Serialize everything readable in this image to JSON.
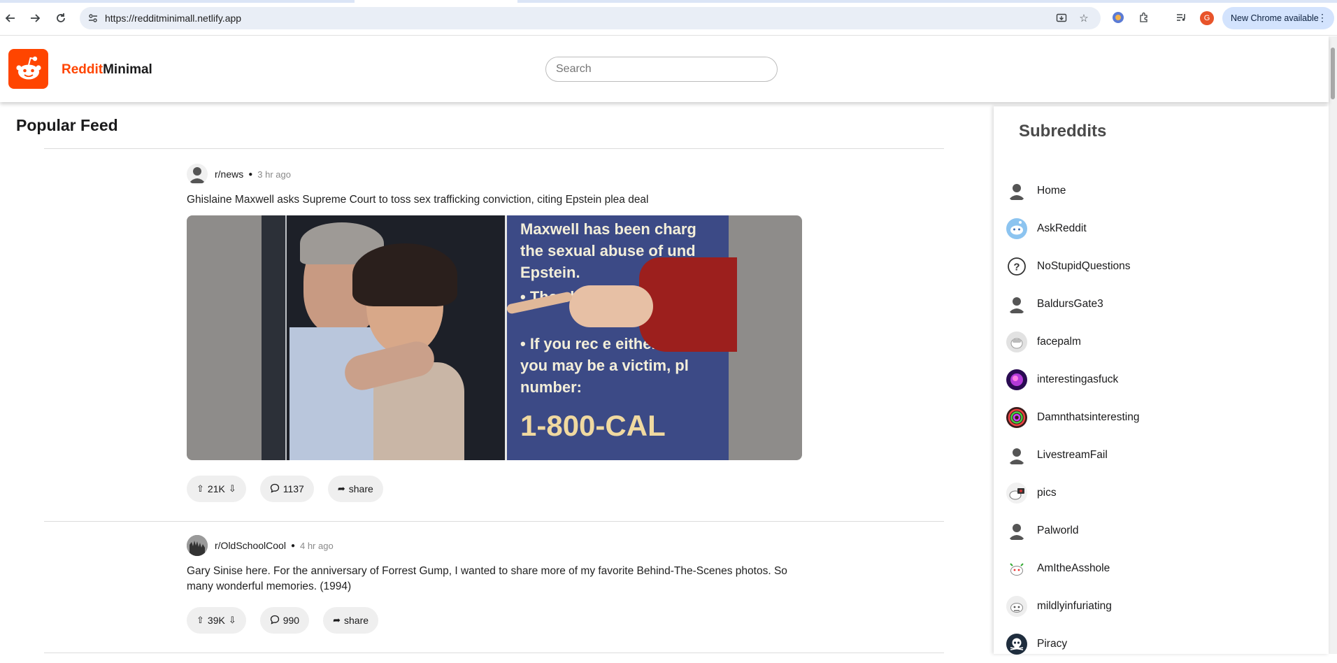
{
  "browser": {
    "url": "https://redditminimall.netlify.app",
    "update_label": "New Chrome available",
    "profile_initial": "G"
  },
  "header": {
    "brand_accent": "Reddit",
    "brand_rest": "Minimal",
    "search_placeholder": "Search"
  },
  "feed": {
    "title": "Popular Feed",
    "posts": [
      {
        "subreddit": "r/news",
        "time": "3 hr ago",
        "title": "Ghislaine Maxwell asks Supreme Court to toss sex trafficking conviction, citing Epstein plea deal",
        "has_image": true,
        "image_text": [
          "Maxwell has been charg",
          "the sexual abuse of und",
          "Epstein.",
          "The charged",
          "If you rec    e either o",
          "you may be a victim, pl",
          "number:",
          "1-800-CAL"
        ],
        "votes": "21K",
        "comments": "1137",
        "share_label": "share"
      },
      {
        "subreddit": "r/OldSchoolCool",
        "time": "4 hr ago",
        "title": "Gary Sinise here. For the anniversary of Forrest Gump, I wanted to share more of my favorite Behind-The-Scenes photos. So many wonderful memories. (1994)",
        "has_image": false,
        "votes": "39K",
        "comments": "990",
        "share_label": "share"
      }
    ]
  },
  "sidebar": {
    "title": "Subreddits",
    "items": [
      {
        "label": "Home",
        "icon": "user-avatar-icon"
      },
      {
        "label": "AskReddit",
        "icon": "snoo-avatar-icon"
      },
      {
        "label": "NoStupidQuestions",
        "icon": "question-icon"
      },
      {
        "label": "BaldursGate3",
        "icon": "user-avatar-icon"
      },
      {
        "label": "facepalm",
        "icon": "facepalm-avatar-icon"
      },
      {
        "label": "interestingasfuck",
        "icon": "purple-avatar-icon"
      },
      {
        "label": "Damnthatsinteresting",
        "icon": "rainbow-avatar-icon"
      },
      {
        "label": "LivestreamFail",
        "icon": "user-avatar-icon"
      },
      {
        "label": "pics",
        "icon": "camera-snoo-icon"
      },
      {
        "label": "Palworld",
        "icon": "user-avatar-icon"
      },
      {
        "label": "AmItheAsshole",
        "icon": "snoo-avatar-icon"
      },
      {
        "label": "mildlyinfuriating",
        "icon": "snoo-avatar-icon"
      },
      {
        "label": "Piracy",
        "icon": "skull-avatar-icon"
      }
    ]
  },
  "colors": {
    "accent": "#ff4500",
    "pill_bg": "#efefef"
  }
}
